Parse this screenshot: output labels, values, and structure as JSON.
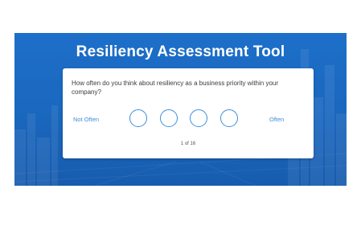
{
  "header": {
    "title": "Resiliency Assessment Tool"
  },
  "question": {
    "text": "How often do you think about resiliency as a business priority within your company?",
    "scale_left_label": "Not Often",
    "scale_right_label": "Often",
    "option_count": 4
  },
  "progress": {
    "text": "1 of 16"
  },
  "colors": {
    "banner_blue": "#1a67be",
    "accent": "#3d8ed9"
  }
}
